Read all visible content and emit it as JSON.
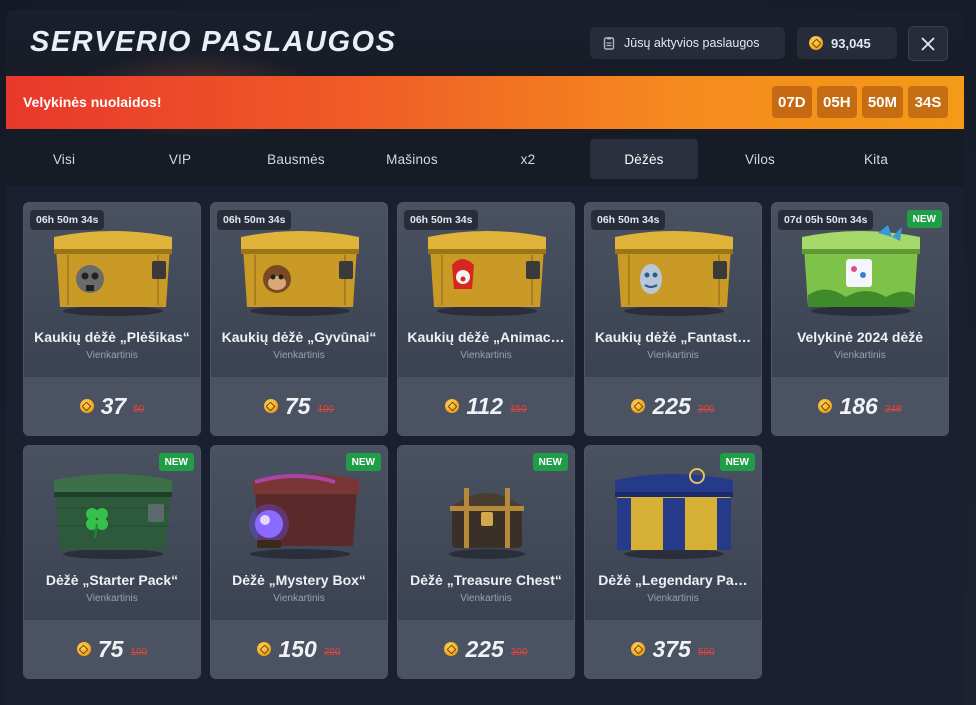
{
  "header": {
    "title": "SERVERIO PASLAUGOS",
    "active_services_label": "Jūsų aktyvios paslaugos",
    "balance": "93,045"
  },
  "banner": {
    "text": "Velykinės nuolaidos!",
    "timer": [
      "07D",
      "05H",
      "50M",
      "34S"
    ]
  },
  "tabs": [
    "Visi",
    "VIP",
    "Bausmės",
    "Mašinos",
    "x2",
    "Dėžės",
    "Vilos",
    "Kita"
  ],
  "active_tab": "Dėžės",
  "colors": {
    "accent_orange": "#f58a1e",
    "new_badge": "#1f9d47",
    "old_price": "#e3453a",
    "coin": "#f0a31a"
  },
  "cards": [
    {
      "name": "Kaukių dėžė „Plėšikas“",
      "type": "Vienkartinis",
      "price": "37",
      "old_price": "50",
      "timer": "06h 50m 34s",
      "is_new": false,
      "icon": "gold-case-skull-sticker"
    },
    {
      "name": "Kaukių dėžė „Gyvūnai“",
      "type": "Vienkartinis",
      "price": "75",
      "old_price": "100",
      "timer": "06h 50m 34s",
      "is_new": false,
      "icon": "gold-case-monkey-sticker"
    },
    {
      "name": "Kaukių dėžė „Animac…",
      "type": "Vienkartinis",
      "price": "112",
      "old_price": "150",
      "timer": "06h 50m 34s",
      "is_new": false,
      "icon": "gold-case-clown-sticker"
    },
    {
      "name": "Kaukių dėžė „Fantast…",
      "type": "Vienkartinis",
      "price": "225",
      "old_price": "300",
      "timer": "06h 50m 34s",
      "is_new": false,
      "icon": "gold-case-fantasy-sticker"
    },
    {
      "name": "Velykinė 2024 dėžė",
      "type": "Vienkartinis",
      "price": "186",
      "old_price": "248",
      "timer": "07d 05h 50m 34s",
      "is_new": true,
      "icon": "easter-case"
    },
    {
      "name": "Dėžė „Starter Pack“",
      "type": "Vienkartinis",
      "price": "75",
      "old_price": "100",
      "timer": "",
      "is_new": true,
      "icon": "green-clover-case"
    },
    {
      "name": "Dėžė „Mystery Box“",
      "type": "Vienkartinis",
      "price": "150",
      "old_price": "200",
      "timer": "",
      "is_new": true,
      "icon": "mystery-case"
    },
    {
      "name": "Dėžė „Treasure Chest“",
      "type": "Vienkartinis",
      "price": "225",
      "old_price": "300",
      "timer": "",
      "is_new": true,
      "icon": "treasure-chest"
    },
    {
      "name": "Dėžė „Legendary Pa…",
      "type": "Vienkartinis",
      "price": "375",
      "old_price": "500",
      "timer": "",
      "is_new": true,
      "icon": "legendary-case"
    }
  ]
}
